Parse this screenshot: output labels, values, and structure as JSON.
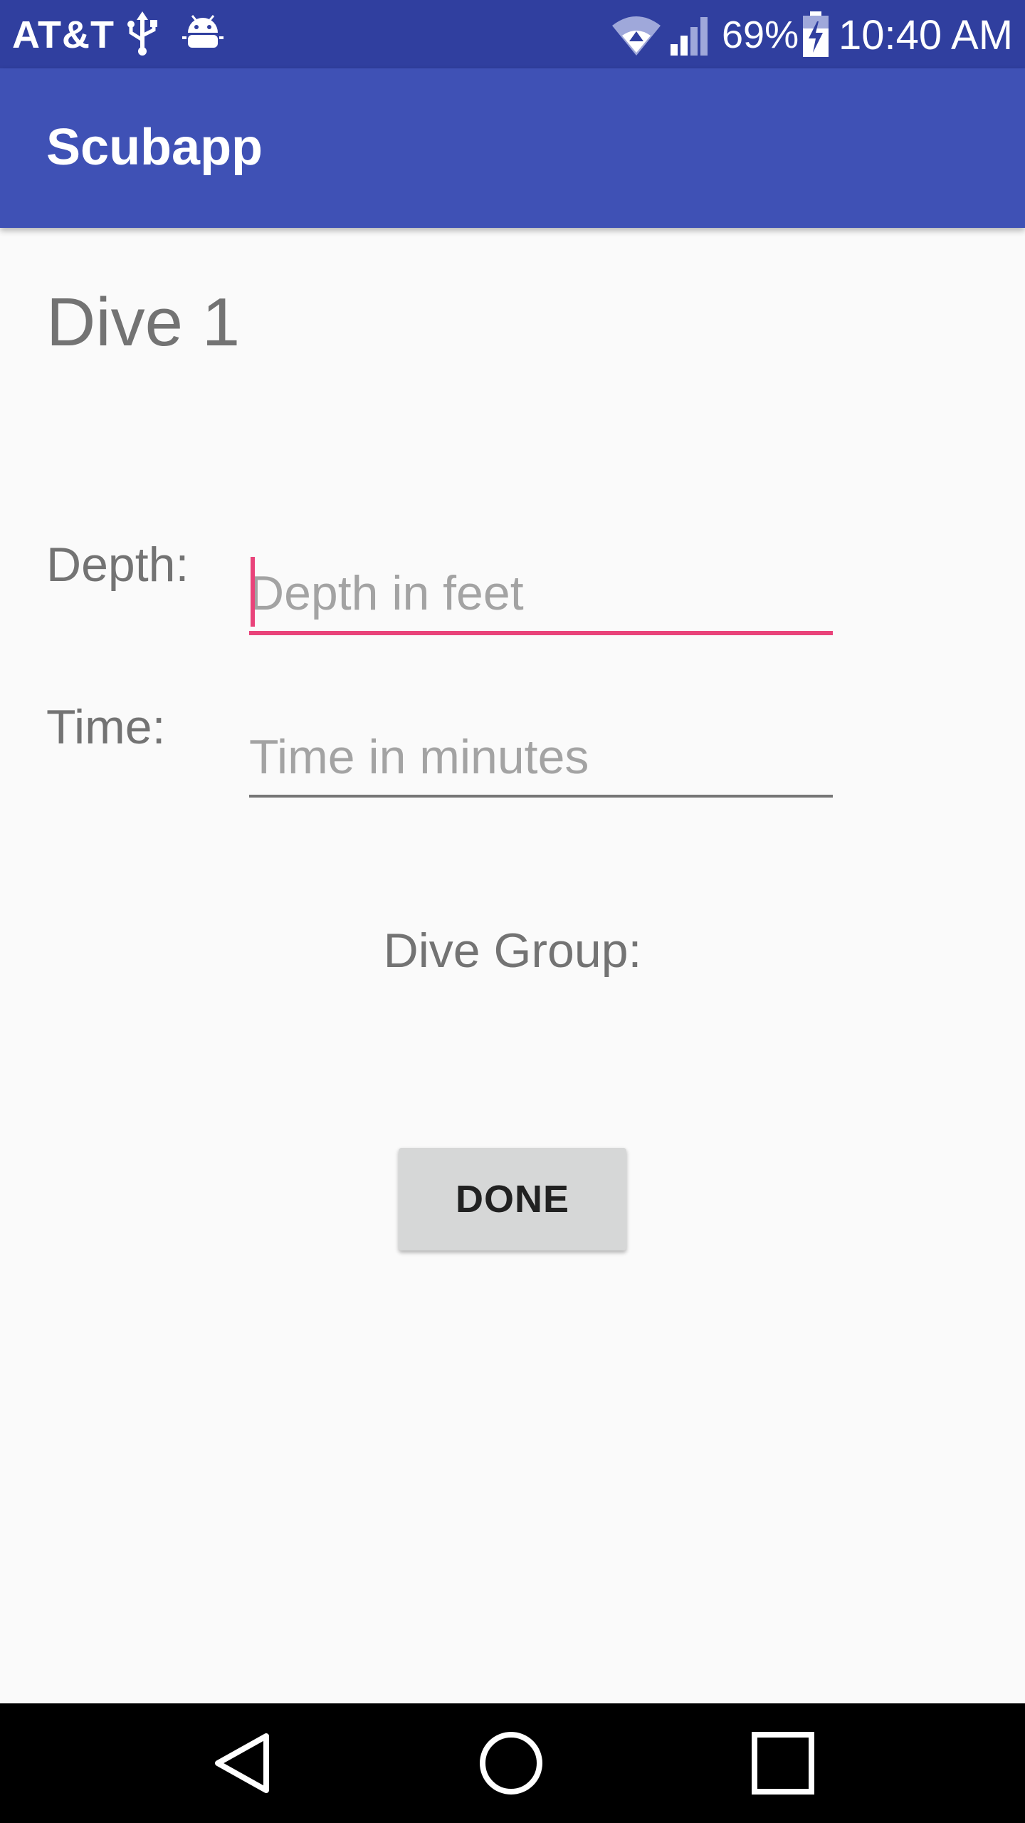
{
  "status_bar": {
    "carrier": "AT&T",
    "battery_percent": "69%",
    "time": "10:40 AM",
    "icons": [
      "usb-icon",
      "debug-icon",
      "wifi-icon",
      "signal-icon",
      "battery-charging-icon"
    ]
  },
  "app_bar": {
    "title": "Scubapp"
  },
  "main": {
    "heading": "Dive 1",
    "depth_label": "Depth:",
    "depth_placeholder": "Depth in feet",
    "time_label": "Time:",
    "time_placeholder": "Time in minutes",
    "dive_group_label": "Dive Group:",
    "done_label": "DONE"
  },
  "nav_bar": {
    "icons": [
      "back-icon",
      "home-icon",
      "recents-icon"
    ]
  },
  "colors": {
    "status_bar": "#303f9f",
    "app_bar": "#3f51b5",
    "accent": "#e9437a",
    "background": "#fafafa"
  }
}
